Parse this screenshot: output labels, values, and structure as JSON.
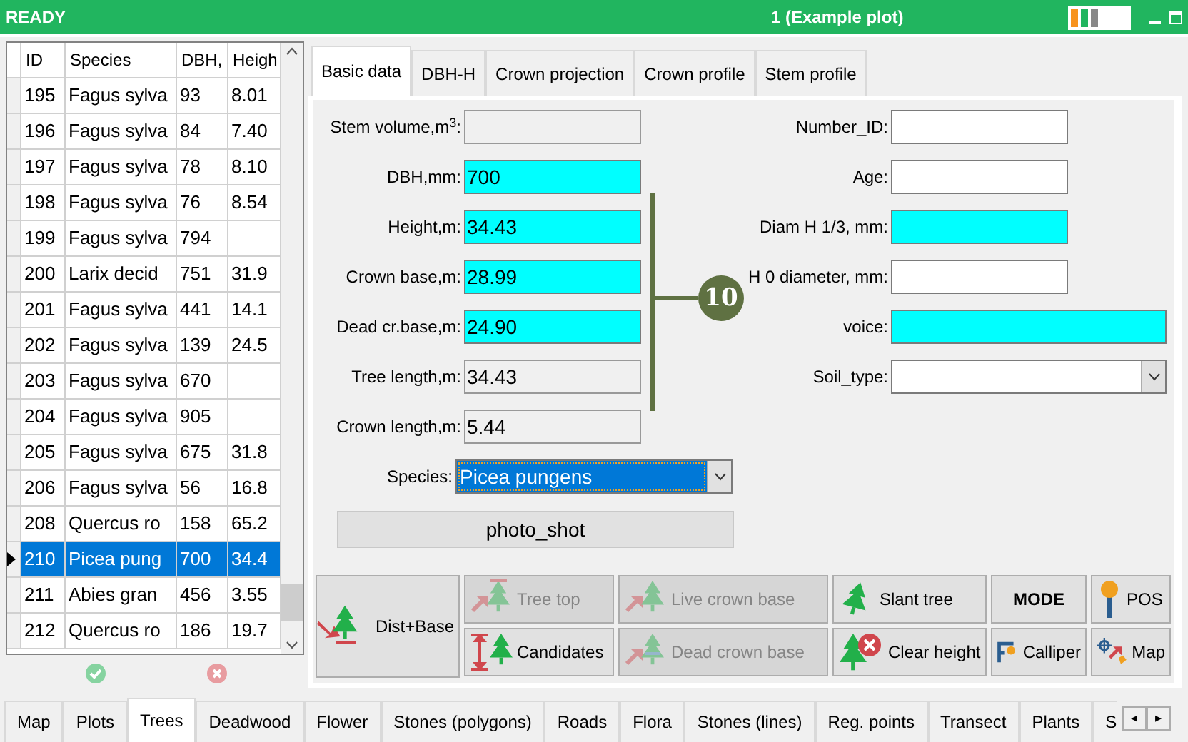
{
  "status": "READY",
  "plot": "1 (Example plot)",
  "table": {
    "columns": [
      "ID",
      "Species",
      "DBH,",
      "Heigh"
    ],
    "rows": [
      {
        "cells": [
          "195",
          "Fagus sylva",
          "93",
          "8.01"
        ],
        "selected": false
      },
      {
        "cells": [
          "196",
          "Fagus sylva",
          "84",
          "7.40"
        ],
        "selected": false
      },
      {
        "cells": [
          "197",
          "Fagus sylva",
          "78",
          "8.10"
        ],
        "selected": false
      },
      {
        "cells": [
          "198",
          "Fagus sylva",
          "76",
          "8.54"
        ],
        "selected": false
      },
      {
        "cells": [
          "199",
          "Fagus sylva",
          "794",
          ""
        ],
        "selected": false
      },
      {
        "cells": [
          "200",
          "Larix decid",
          "751",
          "31.9"
        ],
        "selected": false
      },
      {
        "cells": [
          "201",
          "Fagus sylva",
          "441",
          "14.1"
        ],
        "selected": false
      },
      {
        "cells": [
          "202",
          "Fagus sylva",
          "139",
          "24.5"
        ],
        "selected": false
      },
      {
        "cells": [
          "203",
          "Fagus sylva",
          "670",
          ""
        ],
        "selected": false
      },
      {
        "cells": [
          "204",
          "Fagus sylva",
          "905",
          ""
        ],
        "selected": false
      },
      {
        "cells": [
          "205",
          "Fagus sylva",
          "675",
          "31.8"
        ],
        "selected": false
      },
      {
        "cells": [
          "206",
          "Fagus sylva",
          "56",
          "16.8"
        ],
        "selected": false
      },
      {
        "cells": [
          "208",
          "Quercus ro",
          "158",
          "65.2"
        ],
        "selected": false
      },
      {
        "cells": [
          "210",
          "Picea pung",
          "700",
          "34.4"
        ],
        "selected": true
      },
      {
        "cells": [
          "211",
          "Abies gran",
          "456",
          "3.55"
        ],
        "selected": false
      },
      {
        "cells": [
          "212",
          "Quercus ro",
          "186",
          "19.7"
        ],
        "selected": false
      }
    ]
  },
  "tabs": [
    {
      "label": "Basic data",
      "selected": true
    },
    {
      "label": "DBH-H",
      "selected": false
    },
    {
      "label": "Crown projection",
      "selected": false
    },
    {
      "label": "Crown profile",
      "selected": false
    },
    {
      "label": "Stem profile",
      "selected": false
    }
  ],
  "left_fields": [
    {
      "label": "Stem volume,m$^{3}$:",
      "highlighted": false,
      "readonly": true
    },
    {
      "label": "DBH,mm:",
      "value": "700",
      "highlighted": true,
      "readonly": false
    },
    {
      "label": "Height,m:",
      "value": "34.43",
      "highlighted": true,
      "readonly": false
    },
    {
      "label": "Crown base,m:",
      "value": "28.99",
      "highlighted": true,
      "readonly": false
    },
    {
      "label": "Dead cr.base,m:",
      "value": "24.90",
      "highlighted": true,
      "readonly": false
    },
    {
      "label": "Tree length,m:",
      "value": "34.43",
      "highlighted": false,
      "readonly": true
    },
    {
      "label": "Crown length,m:",
      "value": "5.44",
      "highlighted": false,
      "readonly": true
    }
  ],
  "right_fields": [
    {
      "label": "Number_ID:",
      "highlighted": false,
      "kind": "short"
    },
    {
      "label": "Age:",
      "highlighted": false,
      "kind": "short"
    },
    {
      "label": "Diam H 1/3, mm:",
      "highlighted": true,
      "kind": "short"
    },
    {
      "label": "H 0 diameter, mm:",
      "highlighted": false,
      "kind": "short"
    },
    {
      "label": "voice:",
      "highlighted": true,
      "kind": "wide"
    },
    {
      "label": "Soil_type:",
      "highlighted": false,
      "kind": "select"
    }
  ],
  "badge": "10",
  "species": {
    "label": "Species:",
    "value": "Picea pungens"
  },
  "photo_button": "photo_shot",
  "tool_buttons": [
    {
      "label": "Dist+Base",
      "kind": "dist",
      "disabled": false
    },
    {
      "label": "Tree top",
      "kind": "top",
      "disabled": true
    },
    {
      "label": "Live crown base",
      "kind": "live",
      "disabled": true
    },
    {
      "label": "Slant tree",
      "kind": "slant",
      "disabled": false
    },
    {
      "label": "MODE",
      "kind": "mode",
      "disabled": false
    },
    {
      "label": "POS",
      "kind": "pos",
      "disabled": false
    },
    {
      "label": "Candidates",
      "kind": "candidates",
      "disabled": false
    },
    {
      "label": "Dead crown base",
      "kind": "dead",
      "disabled": true
    },
    {
      "label": "Clear height",
      "kind": "clear",
      "disabled": false
    },
    {
      "label": "Calliper",
      "kind": "calliper",
      "disabled": false
    },
    {
      "label": "Map",
      "kind": "map",
      "disabled": false
    }
  ],
  "bottom_tabs": [
    {
      "label": "Map",
      "selected": false
    },
    {
      "label": "Plots",
      "selected": false
    },
    {
      "label": "Trees",
      "selected": true
    },
    {
      "label": "Deadwood",
      "selected": false
    },
    {
      "label": "Flower",
      "selected": false
    },
    {
      "label": "Stones (polygons)",
      "selected": false
    },
    {
      "label": "Roads",
      "selected": false
    },
    {
      "label": "Flora",
      "selected": false
    },
    {
      "label": "Stones (lines)",
      "selected": false
    },
    {
      "label": "Reg. points",
      "selected": false
    },
    {
      "label": "Transect",
      "selected": false
    },
    {
      "label": "Plants",
      "selected": false
    },
    {
      "label": "S",
      "selected": false
    }
  ],
  "tab_scroll": [
    "◂",
    "▸"
  ]
}
